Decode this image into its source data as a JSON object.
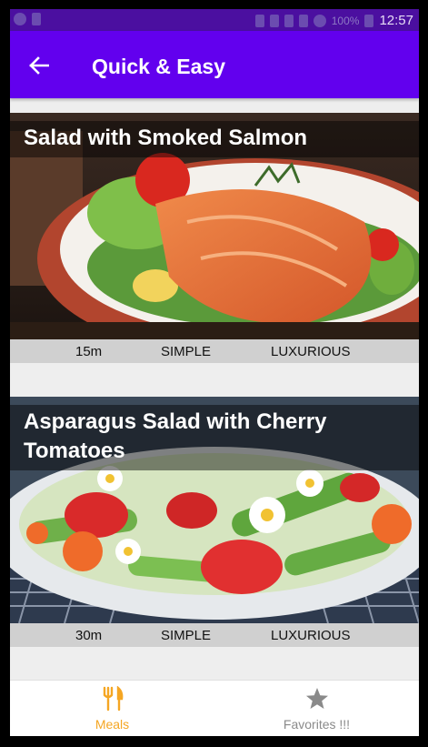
{
  "status_bar": {
    "battery": "100%",
    "time": "12:57"
  },
  "app_bar": {
    "title": "Quick & Easy",
    "back_icon": "arrow-left-icon"
  },
  "meals": [
    {
      "title": "Salad with Smoked Salmon",
      "duration": "15m",
      "complexity": "SIMPLE",
      "affordability": "LUXURIOUS"
    },
    {
      "title": "Asparagus Salad with Cherry Tomatoes",
      "duration": "30m",
      "complexity": "SIMPLE",
      "affordability": "LUXURIOUS"
    }
  ],
  "bottom_nav": {
    "items": [
      {
        "label": "Meals",
        "icon": "fork-knife-icon",
        "active": true
      },
      {
        "label": "Favorites !!!",
        "icon": "star-icon",
        "active": false
      }
    ]
  },
  "colors": {
    "primary": "#6200ee",
    "status": "#4b0fa0",
    "accent": "#f5a623"
  }
}
